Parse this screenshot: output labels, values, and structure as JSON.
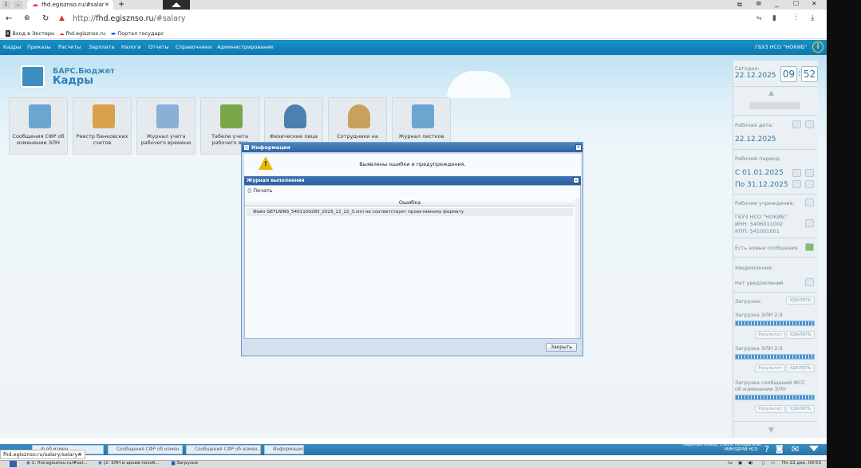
{
  "browser": {
    "tab_title": "fhd.egisznso.ru/#salar",
    "url_host": "http://",
    "url_domain": "fhd.egisznso.ru",
    "url_path": "/#salary",
    "bookmarks": [
      "Вход в Экстерн",
      "fhd.egisznso.ru",
      "Портал государс"
    ]
  },
  "menu": {
    "items": [
      "Кадры",
      "Приказы",
      "Расчеты",
      "Зарплата",
      "Налоги",
      "Отчеты",
      "Справочники",
      "Администрирование"
    ],
    "org": "ГБУЗ НСО \"НОКИБ\""
  },
  "brand": {
    "line1": "БАРС.Бюджет",
    "line2": "Кадры"
  },
  "tiles": [
    {
      "label": "Сообщения СФР об изменении ЭЛН",
      "color": "#6aa6cf"
    },
    {
      "label": "Реестр банковских счетов",
      "color": "#d7a24a"
    },
    {
      "label": "Журнал учета рабочего времени",
      "color": "#8bb0d6"
    },
    {
      "label": "Табели учета рабочего вре",
      "color": "#7aa64a"
    },
    {
      "label": "Физические лица",
      "color": "#4d7fb0"
    },
    {
      "label": "Сотрудники на",
      "color": "#c9a15c"
    },
    {
      "label": "Журнал листков",
      "color": "#6aa6cf"
    }
  ],
  "dialog": {
    "title": "Информация",
    "message": "Выявлены ошибки и предупреждения.",
    "log_title": "Журнал выполнения",
    "print_label": "Печать",
    "column_header": "Ошибка",
    "rows": [
      "Файл GETLNINS_5401100283_2025_12_22_3.xml не соответствует проактивному формату"
    ],
    "close_label": "Закрыть"
  },
  "sidebar": {
    "today_label": "Сегодня:",
    "today_date": "22.12.2025",
    "hour": "09",
    "minute": "52",
    "work_date_label": "Рабочая дата:",
    "work_date": "22.12.2025",
    "period_label": "Рабочий период:",
    "period_from": "С   01.01.2025",
    "period_to": "По  31.12.2025",
    "org_label": "Рабочие учреждения:",
    "org_name": "ГБУЗ НСО \"НОКИБ\"",
    "org_inn": "ИНН: 5406011002",
    "org_kpp": "КПП: 541001001",
    "new_messages": "Есть новые сообщения",
    "notif_label": "Уведомления:",
    "notif_value": "Нет уведомлений",
    "downloads_label": "Загрузки:",
    "delete_label": "УДАЛИТЬ",
    "result_label": "Результат",
    "downloads": [
      {
        "name": "Загрузка ЭЛН 2.0",
        "progress": 1.0
      },
      {
        "name": "Загрузка ЭЛН 2.0",
        "progress": 1.0
      },
      {
        "name": "Загрузка сообщений ФСС об изменении ЭЛН",
        "progress": 1.0
      }
    ]
  },
  "taskbar": {
    "tabs": [
      "ф об измен..",
      "Сообщения СФР об измен..",
      "Сообщения СФР об измен..",
      "Информация"
    ],
    "license": "Лицензия номер: 15626; Обладатель:",
    "license2": "МИНЗДРАВ НСО",
    "status_url": "fhd.egisznso.ru/salary/salary#"
  },
  "os_taskbar": {
    "items": [
      "1: fhd.egisznso.ru/#sal...",
      "[2: ЗЛН и архив пособ...",
      "Загрузки"
    ],
    "lang": "ru",
    "clock": "Пн 22 дек, 09:53"
  }
}
